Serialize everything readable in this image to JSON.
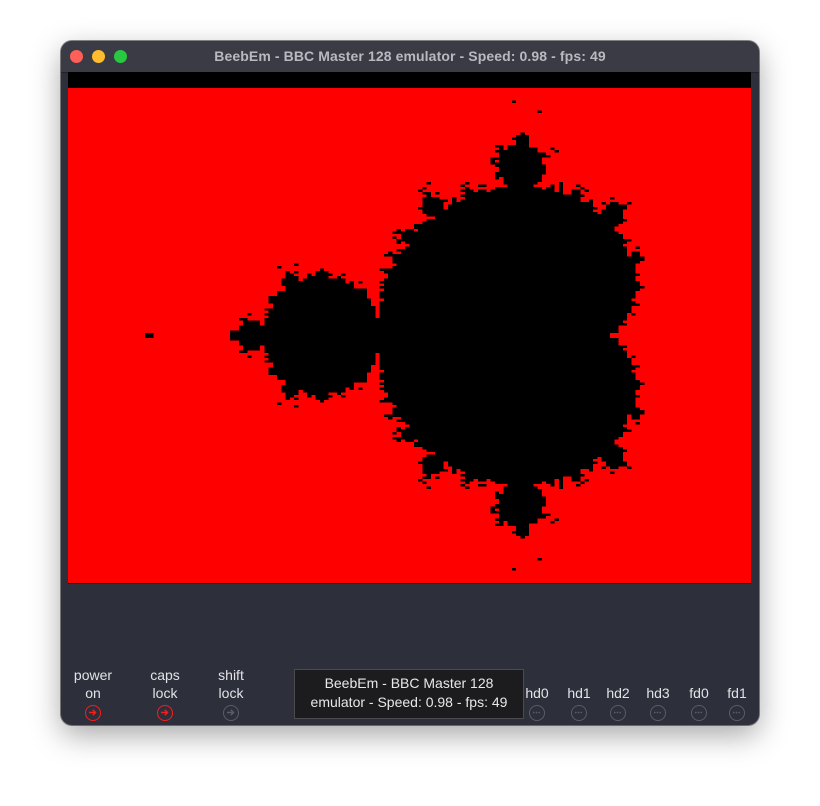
{
  "window": {
    "title": "BeebEm - BBC Master 128 emulator - Speed: 0.98 - fps: 49"
  },
  "screen": {
    "content": "Mandelbrot set",
    "background_color": "#ff0000",
    "set_color": "#000000",
    "border_color": "#000000"
  },
  "status_bar": {
    "leds": [
      {
        "line1": "power",
        "line2": "on",
        "state": "on",
        "icon": "arrow-right-circle-icon"
      },
      {
        "line1": "caps",
        "line2": "lock",
        "state": "on",
        "icon": "arrow-right-circle-icon"
      },
      {
        "line1": "shift",
        "line2": "lock",
        "state": "off",
        "icon": "arrow-right-circle-icon"
      }
    ],
    "drives": [
      {
        "label": "hd0",
        "icon": "ellipsis-circle-icon"
      },
      {
        "label": "hd1",
        "icon": "ellipsis-circle-icon"
      },
      {
        "label": "hd2",
        "icon": "ellipsis-circle-icon"
      },
      {
        "label": "hd3",
        "icon": "ellipsis-circle-icon"
      },
      {
        "label": "fd0",
        "icon": "ellipsis-circle-icon"
      },
      {
        "label": "fd1",
        "icon": "ellipsis-circle-icon"
      }
    ],
    "led_on_color": "#ff1a1a",
    "led_off_color": "#5a5c66"
  },
  "tooltip": {
    "line1": "BeebEm - BBC Master 128",
    "line2": "emulator - Speed: 0.98 - fps: 49"
  }
}
